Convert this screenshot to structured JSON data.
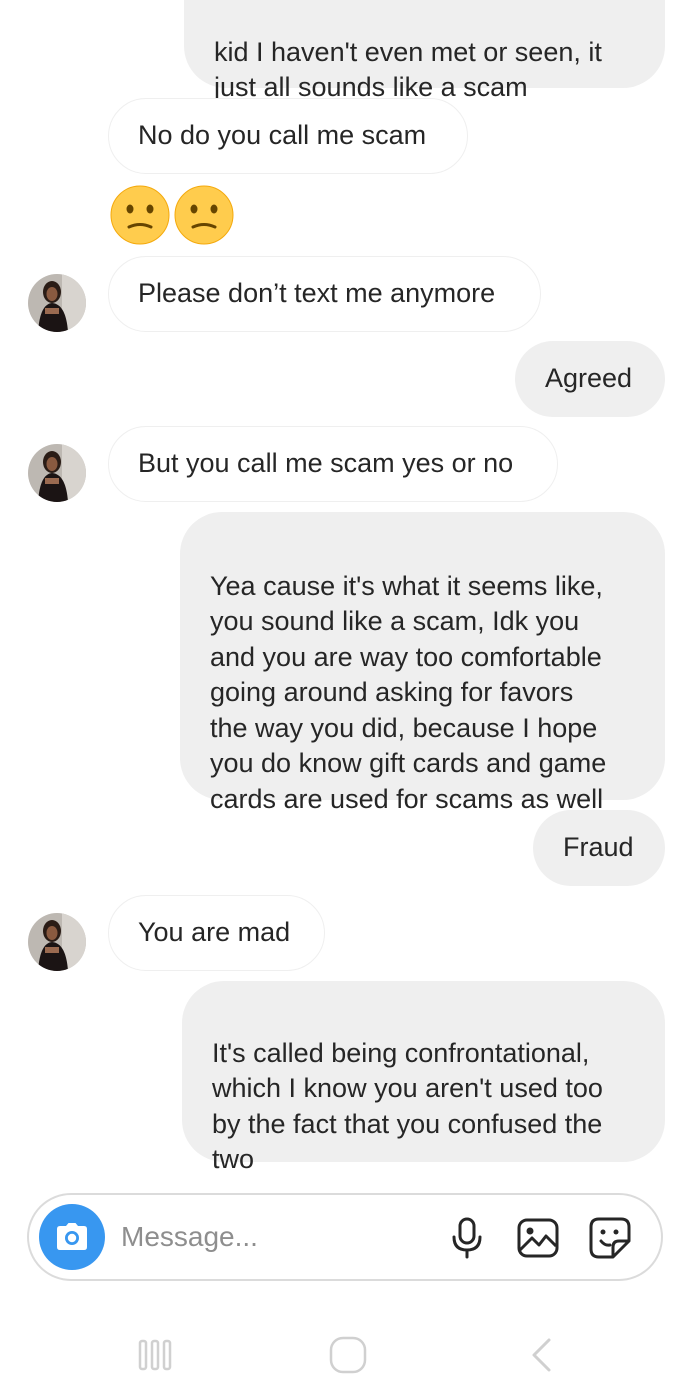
{
  "messages": [
    {
      "side": "out",
      "text": "kid I haven't even met or seen, it\njust all sounds like a scam"
    },
    {
      "side": "in",
      "text": "No do you call me scam"
    },
    {
      "side": "in",
      "emoji": [
        "confused-face",
        "confused-face"
      ]
    },
    {
      "side": "in",
      "text": "Please don’t text me anymore"
    },
    {
      "side": "out",
      "text": "Agreed"
    },
    {
      "side": "in",
      "text": "But you call me scam yes or no"
    },
    {
      "side": "out",
      "text": "Yea cause it's what it seems like,\nyou sound like a scam, Idk you\nand you are way too comfortable\ngoing around asking for favors\nthe way you did, because I hope\nyou do know gift cards and game\ncards are used for scams as well"
    },
    {
      "side": "out",
      "text": "Fraud"
    },
    {
      "side": "in",
      "text": "You are mad"
    },
    {
      "side": "out",
      "text": "It's called being confrontational,\nwhich I know you aren't used too\nby the fact that you confused the\ntwo"
    }
  ],
  "composer": {
    "placeholder": "Message...",
    "icons": [
      "camera-icon",
      "microphone-icon",
      "gallery-icon",
      "sticker-icon"
    ]
  },
  "navbar": {
    "icons": [
      "recent-apps-icon",
      "home-icon",
      "back-icon"
    ]
  },
  "colors": {
    "outgoing_bubble": "#efefef",
    "incoming_border": "#efefef",
    "camera_button": "#3897f0",
    "text": "#262626",
    "placeholder": "#8e8e8e",
    "emoji_face": "#ffcc4d"
  }
}
